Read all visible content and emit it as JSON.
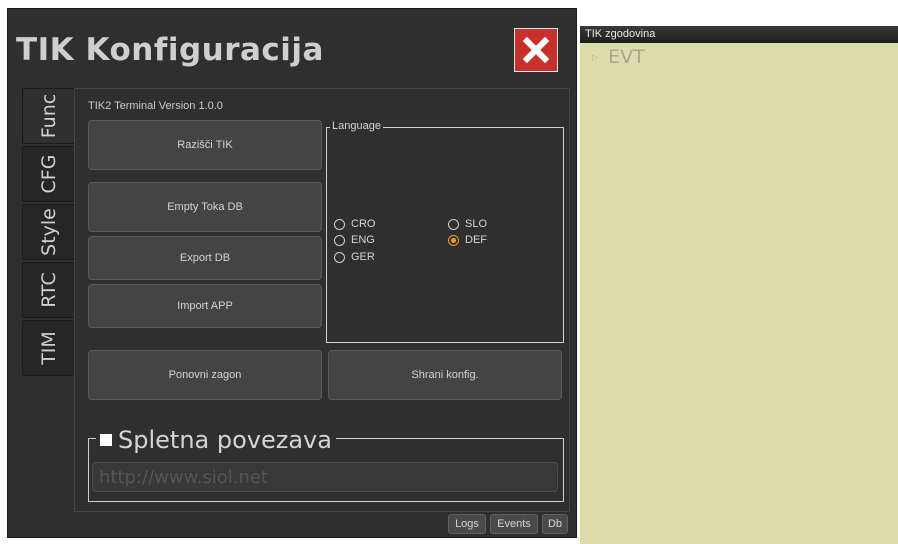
{
  "window": {
    "title": "TIK Konfiguracija"
  },
  "tabs": [
    {
      "label": "Func"
    },
    {
      "label": "CFG"
    },
    {
      "label": "Style"
    },
    {
      "label": "RTC"
    },
    {
      "label": "TIM"
    }
  ],
  "version_label": "TIK2 Terminal Version 1.0.0",
  "buttons": {
    "razisci": "Razišči TIK",
    "empty_toka": "Empty Toka DB",
    "export_db": "Export DB",
    "import_app": "Import APP",
    "ponovni_zagon": "Ponovni zagon",
    "shrani_konfig": "Shrani konfig."
  },
  "language": {
    "title": "Language",
    "options": [
      {
        "label": "CRO",
        "checked": false
      },
      {
        "label": "SLO",
        "checked": false
      },
      {
        "label": "ENG",
        "checked": false
      },
      {
        "label": "DEF",
        "checked": true
      },
      {
        "label": "GER",
        "checked": false
      }
    ]
  },
  "web": {
    "title": "Spletna povezava",
    "placeholder": "http://www.siol.net"
  },
  "bottom_buttons": {
    "logs": "Logs",
    "events": "Events",
    "db": "Db"
  },
  "history": {
    "title": "TIK zgodovina",
    "items": [
      {
        "label": "EVT"
      }
    ]
  },
  "colors": {
    "accent_close": "#c8312b",
    "radio_checked": "#f0a020",
    "history_bg": "#dddcab"
  }
}
